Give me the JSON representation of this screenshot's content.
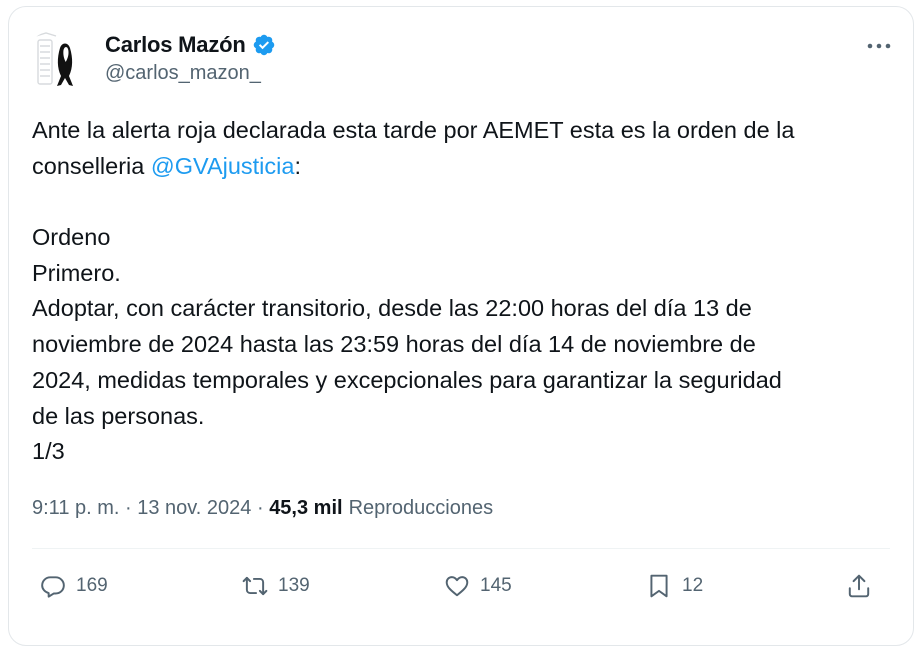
{
  "author": {
    "name": "Carlos Mazón",
    "handle": "@carlos_mazon_"
  },
  "tweet": {
    "line1": "Ante la alerta roja declarada esta tarde por AEMET esta es la orden de la",
    "line2_prefix": "conselleria ",
    "mention": "@GVAjusticia",
    "line2_suffix": ":",
    "line3": "",
    "line4": "Ordeno",
    "line5": "Primero.",
    "line6": "Adoptar, con carácter transitorio, desde las 22:00 horas del día 13 de",
    "line7": "noviembre de 2024 hasta las 23:59 horas del día 14 de noviembre de",
    "line8": "2024, medidas temporales y excepcionales para garantizar la seguridad",
    "line9": "de las personas.",
    "line10": "1/3"
  },
  "meta": {
    "time": "9:11 p. m.",
    "sep1": " · ",
    "date": "13 nov. 2024",
    "sep2": " · ",
    "views_count": "45,3 mil",
    "views_label": "Reproducciones"
  },
  "actions": {
    "replies": "169",
    "reposts": "139",
    "likes": "145",
    "bookmarks": "12"
  },
  "colors": {
    "accent": "#1d9bf0",
    "secondary_text": "#536471",
    "primary_text": "#0f1419"
  }
}
